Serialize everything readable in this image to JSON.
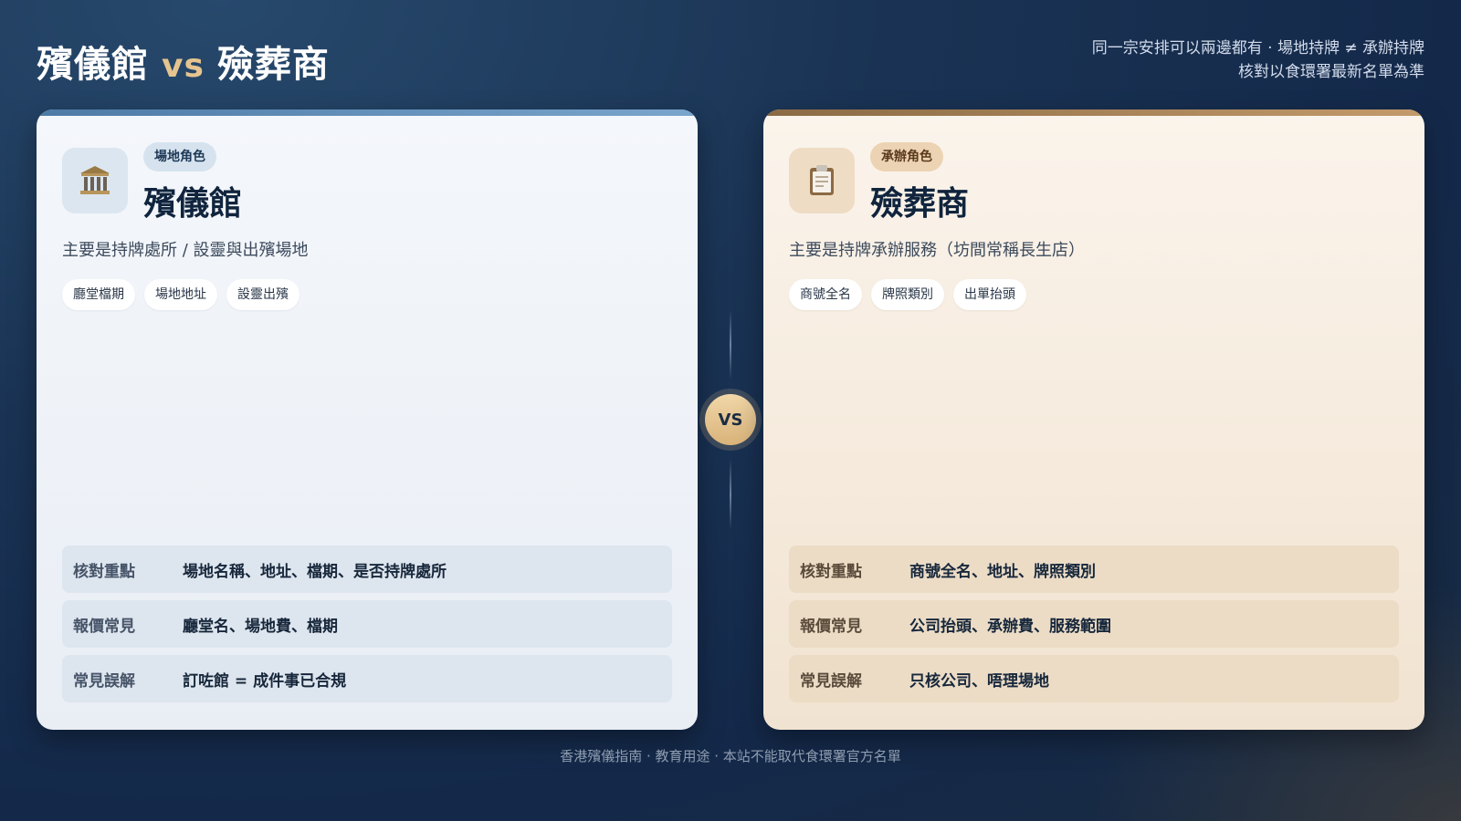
{
  "header": {
    "title_left": "殯儀館",
    "title_vs": "vs",
    "title_right": "殮葬商",
    "note_line1": "同一宗安排可以兩邊都有 · 場地持牌 ≠ 承辦持牌",
    "note_line2": "核對以食環署最新名單為準"
  },
  "center": {
    "vs_label": "VS"
  },
  "left_card": {
    "icon": "classical-building-icon",
    "badge": "場地角色",
    "title": "殯儀館",
    "description": "主要是持牌處所 / 設靈與出殯場地",
    "tags": [
      "廳堂檔期",
      "場地地址",
      "設靈出殯"
    ],
    "rows": [
      {
        "label": "核對重點",
        "value": "場地名稱、地址、檔期、是否持牌處所"
      },
      {
        "label": "報價常見",
        "value": "廳堂名、場地費、檔期"
      },
      {
        "label": "常見誤解",
        "value": "訂咗館 = 成件事已合規"
      }
    ]
  },
  "right_card": {
    "icon": "clipboard-icon",
    "badge": "承辦角色",
    "title": "殮葬商",
    "description": "主要是持牌承辦服務（坊間常稱長生店）",
    "tags": [
      "商號全名",
      "牌照類別",
      "出單抬頭"
    ],
    "rows": [
      {
        "label": "核對重點",
        "value": "商號全名、地址、牌照類別"
      },
      {
        "label": "報價常見",
        "value": "公司抬頭、承辦費、服務範圍"
      },
      {
        "label": "常見誤解",
        "value": "只核公司、唔理場地"
      }
    ]
  },
  "footer": {
    "text": "香港殯儀指南 · 教育用途 · 本站不能取代食環署官方名單"
  },
  "colors": {
    "background": "#1a3354",
    "accent_gold": "#e6c48f",
    "left_accent": "#4d7ba6",
    "right_accent": "#a07c52"
  }
}
